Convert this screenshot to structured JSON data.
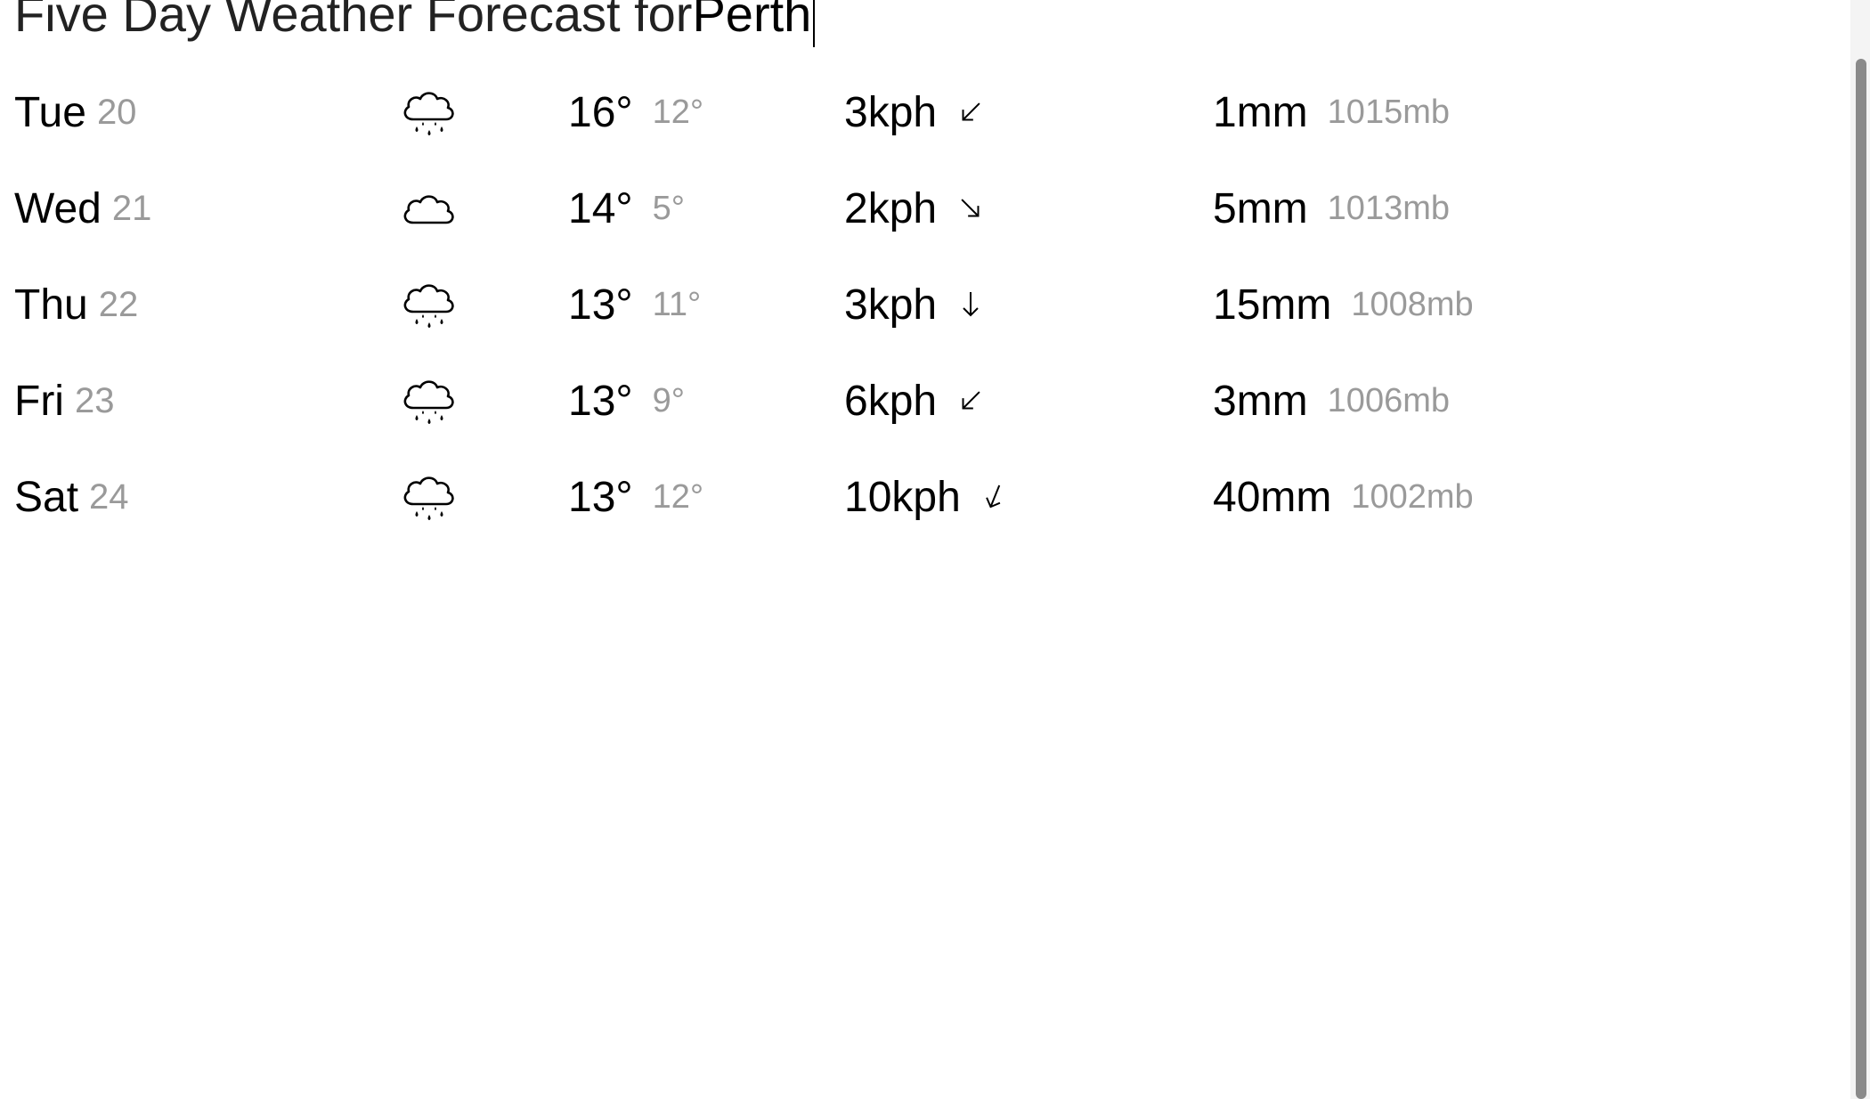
{
  "header": {
    "title_prefix": "Five Day Weather Forecast for ",
    "city": "Perth"
  },
  "forecast": [
    {
      "day": "Tue",
      "date": "20",
      "icon": "rain-cloud-icon",
      "temp_high": "16°",
      "temp_low": "12°",
      "wind_speed": "3kph",
      "wind_direction": "south-west",
      "rain": "1mm",
      "pressure": "1015mb"
    },
    {
      "day": "Wed",
      "date": "21",
      "icon": "cloud-icon",
      "temp_high": "14°",
      "temp_low": "5°",
      "wind_speed": "2kph",
      "wind_direction": "south-east",
      "rain": "5mm",
      "pressure": "1013mb"
    },
    {
      "day": "Thu",
      "date": "22",
      "icon": "rain-cloud-icon",
      "temp_high": "13°",
      "temp_low": "11°",
      "wind_speed": "3kph",
      "wind_direction": "south",
      "rain": "15mm",
      "pressure": "1008mb"
    },
    {
      "day": "Fri",
      "date": "23",
      "icon": "rain-cloud-icon",
      "temp_high": "13°",
      "temp_low": "9°",
      "wind_speed": "6kph",
      "wind_direction": "south-west",
      "rain": "3mm",
      "pressure": "1006mb"
    },
    {
      "day": "Sat",
      "date": "24",
      "icon": "rain-cloud-icon",
      "temp_high": "13°",
      "temp_low": "12°",
      "wind_speed": "10kph",
      "wind_direction": "south-southwest",
      "rain": "40mm",
      "pressure": "1002mb"
    }
  ],
  "colors": {
    "primary_text": "#000000",
    "secondary_text": "#9a9a9a",
    "background": "#ffffff",
    "scrollbar_thumb": "#8a8a8a"
  }
}
